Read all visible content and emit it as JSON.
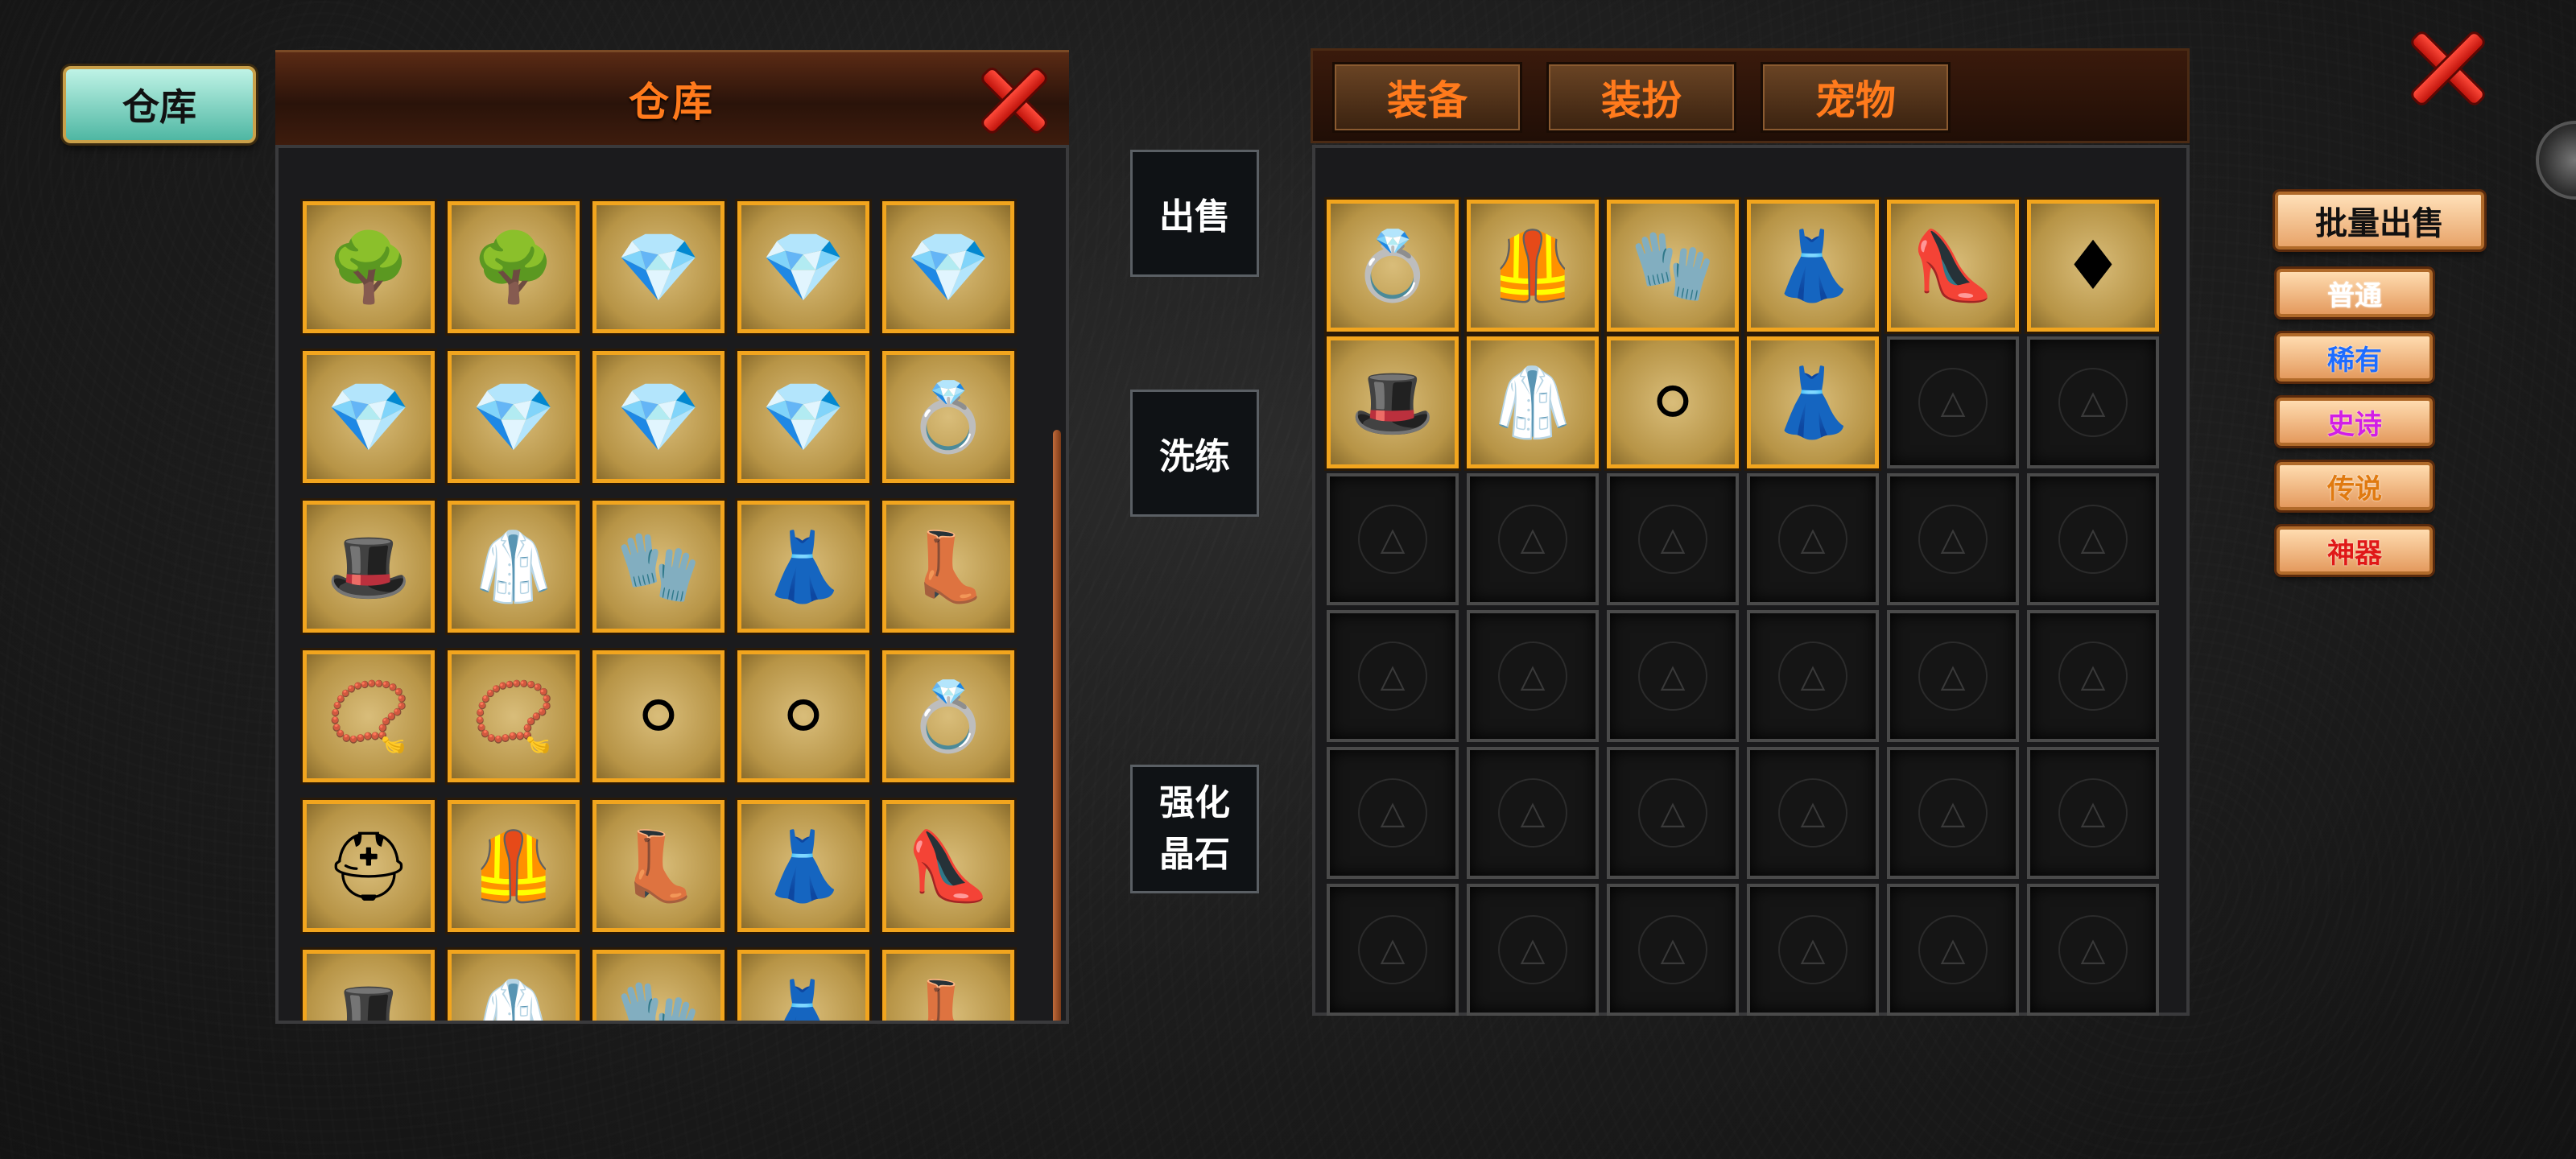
{
  "warehouse_tab": {
    "label": "仓库"
  },
  "left_panel": {
    "title": "仓库",
    "grid": [
      [
        "tree-monster",
        "tree-monster",
        "gem-silver",
        "gem-cyan",
        "gem-pink"
      ],
      [
        "gem-violet",
        "gem-green",
        "gem-beige",
        "gem-red",
        "ring-silver"
      ],
      [
        "hat-white",
        "robe-white",
        "gloves-white",
        "skirt-white",
        "boots-white"
      ],
      [
        "necklace-pearl",
        "necklace-pearl",
        "earring-pearl",
        "earring-pearl",
        "ring-silver"
      ],
      [
        "helmet-red",
        "armor-red",
        "boots-white",
        "skirt-dark",
        "shoes-red"
      ],
      [
        "hat-white",
        "robe-white",
        "gloves-white",
        "skirt-white",
        "boots-white"
      ]
    ]
  },
  "middle_buttons": {
    "sell": "出售",
    "refine": "洗练",
    "enhance_line1": "强化",
    "enhance_line2": "晶石"
  },
  "right_tabs": [
    "装备",
    "装扮",
    "宠物"
  ],
  "right_grid": [
    [
      "ring-gold",
      "armor-red",
      "gloves-red",
      "skirt-dark",
      "shoes-red",
      "earring-red"
    ],
    [
      "hat-white",
      "robe-white",
      "earring-pearl",
      "skirt-white",
      "empty",
      "empty"
    ],
    [
      "empty",
      "empty",
      "empty",
      "empty",
      "empty",
      "empty"
    ],
    [
      "empty",
      "empty",
      "empty",
      "empty",
      "empty",
      "empty"
    ],
    [
      "empty",
      "empty",
      "empty",
      "empty",
      "empty",
      "empty"
    ],
    [
      "empty",
      "empty",
      "empty",
      "empty",
      "empty",
      "empty"
    ]
  ],
  "filters": {
    "bulk_sell": "批量出售",
    "items": [
      {
        "label": "普通",
        "color": "#ffffff"
      },
      {
        "label": "稀有",
        "color": "#1e6cff"
      },
      {
        "label": "史诗",
        "color": "#d21ee6"
      },
      {
        "label": "传说",
        "color": "#e07a10"
      },
      {
        "label": "神器",
        "color": "#e01818"
      }
    ]
  },
  "icons": {
    "tree-monster": "🌳",
    "gem-silver": "💎",
    "gem-cyan": "💎",
    "gem-pink": "💎",
    "gem-violet": "💎",
    "gem-green": "💎",
    "gem-beige": "💎",
    "gem-red": "💎",
    "ring-silver": "💍",
    "ring-gold": "💍",
    "hat-white": "🎩",
    "robe-white": "🥼",
    "gloves-white": "🧤",
    "gloves-red": "🧤",
    "skirt-white": "👗",
    "skirt-dark": "👗",
    "boots-white": "👢",
    "shoes-red": "👠",
    "necklace-pearl": "📿",
    "earring-pearl": "⚪",
    "earring-red": "♦",
    "helmet-red": "⛑",
    "armor-red": "🦺"
  }
}
